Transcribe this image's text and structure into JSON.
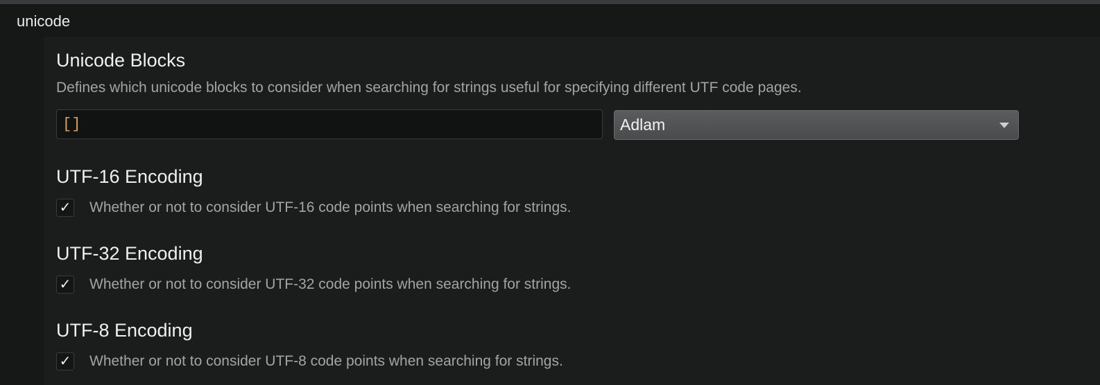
{
  "category": {
    "title": "unicode"
  },
  "settings": {
    "unicode_blocks": {
      "title": "Unicode Blocks",
      "description": "Defines which unicode blocks to consider when searching for strings useful for specifying different UTF code pages.",
      "input_value": "[]",
      "dropdown_selected": "Adlam"
    },
    "utf16": {
      "title": "UTF-16 Encoding",
      "description": "Whether or not to consider UTF-16 code points when searching for strings.",
      "checked": true,
      "check_glyph": "✓"
    },
    "utf32": {
      "title": "UTF-32 Encoding",
      "description": "Whether or not to consider UTF-32 code points when searching for strings.",
      "checked": true,
      "check_glyph": "✓"
    },
    "utf8": {
      "title": "UTF-8 Encoding",
      "description": "Whether or not to consider UTF-8 code points when searching for strings.",
      "checked": true,
      "check_glyph": "✓"
    }
  },
  "colors": {
    "background": "#161717",
    "panel": "#1b1c1c",
    "input_text": "#e0a060",
    "description_text": "#a4a4a4"
  },
  "icons": {
    "dropdown": "chevron-down-icon",
    "checkbox": "checkmark-icon"
  }
}
